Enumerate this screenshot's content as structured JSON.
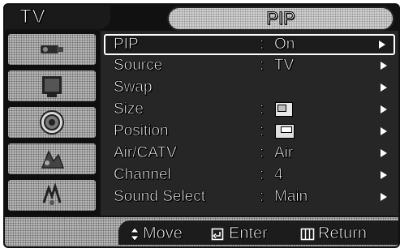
{
  "header": {
    "source_tab": "TV",
    "menu_title": "PIP"
  },
  "sidebar": {
    "icons": [
      {
        "name": "input-icon"
      },
      {
        "name": "picture-icon"
      },
      {
        "name": "sound-icon"
      },
      {
        "name": "channel-icon"
      },
      {
        "name": "setup-icon"
      }
    ]
  },
  "menu": {
    "rows": [
      {
        "label": "PIP",
        "value": "On",
        "selected": true
      },
      {
        "label": "Source",
        "value": "TV"
      },
      {
        "label": "Swap",
        "value": ""
      },
      {
        "label": "Size",
        "value": ""
      },
      {
        "label": "Position",
        "value": ""
      },
      {
        "label": "Air/CATV",
        "value": "Air"
      },
      {
        "label": "Channel",
        "value": "4"
      },
      {
        "label": "Sound Select",
        "value": "Main"
      }
    ],
    "separator": ":"
  },
  "footer": {
    "move_label": "Move",
    "enter_label": "Enter",
    "return_label": "Return"
  }
}
